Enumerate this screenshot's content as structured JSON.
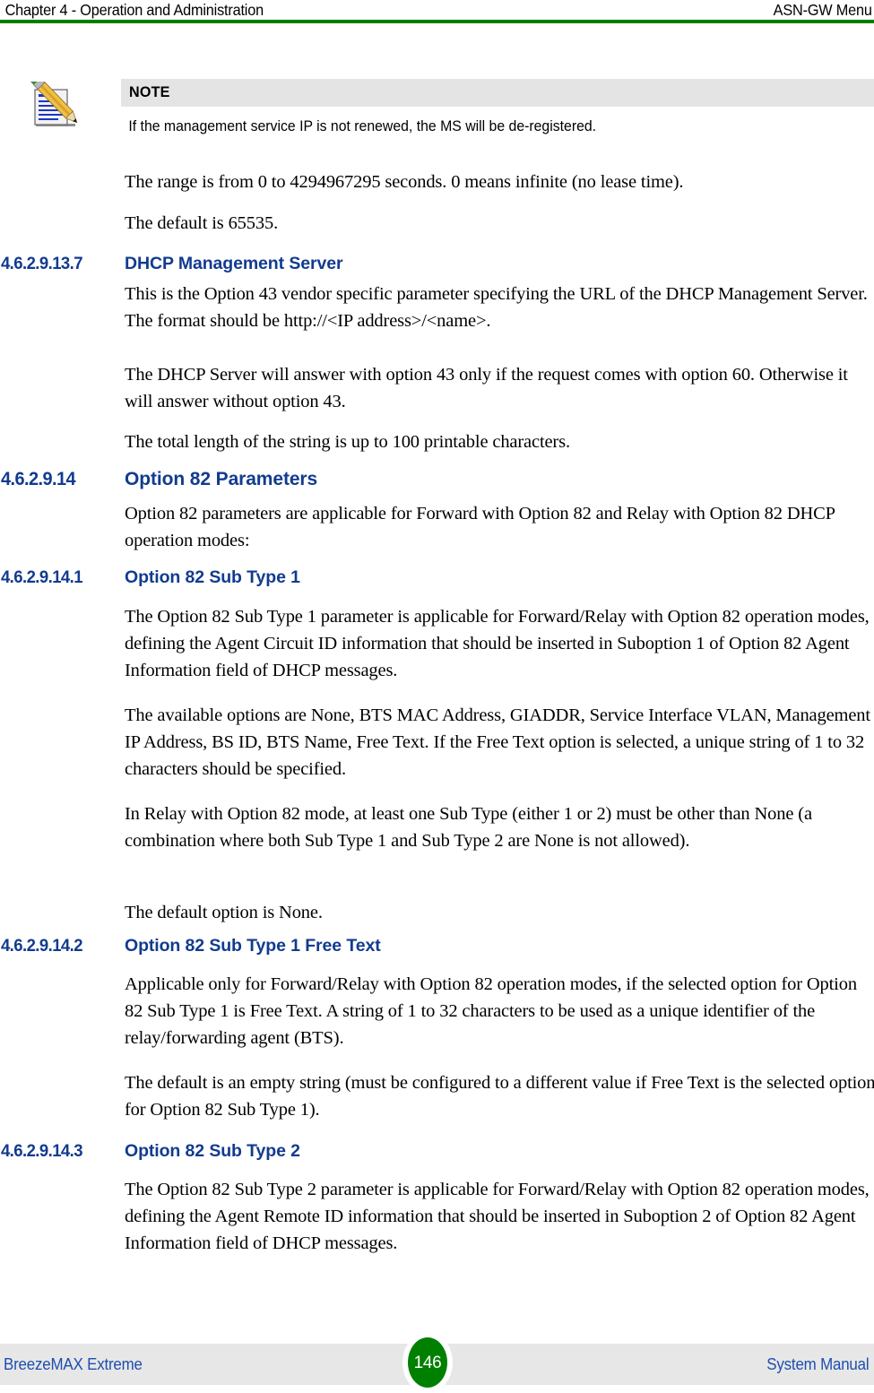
{
  "header": {
    "left": "Chapter 4 - Operation and Administration",
    "right": "ASN-GW Menu",
    "rule_color": "#008000"
  },
  "note": {
    "icon": "note-pencil-icon",
    "title": "NOTE",
    "text": "If the management service IP is not renewed, the MS will be de-registered.",
    "title_bar_color": "#e4e4e4"
  },
  "intro_paragraphs": [
    "The range is from 0 to 4294967295 seconds. 0 means infinite (no lease time).",
    "The default is 65535."
  ],
  "sections": [
    {
      "number": "4.6.2.9.13.7",
      "title": "DHCP Management Server",
      "level": 7,
      "paragraphs": [
        "This is the Option 43 vendor specific parameter specifying the URL of the DHCP Management Server. The format should be http://<IP address>/<name>.",
        "The DHCP Server will answer with option 43 only if the request comes with option 60. Otherwise it will answer without option 43.",
        "The total length of the string is up to 100 printable characters."
      ]
    },
    {
      "number": "4.6.2.9.14",
      "title": "Option 82 Parameters",
      "level": 6,
      "paragraphs": [
        "Option 82 parameters are applicable for Forward with Option 82 and Relay with Option 82 DHCP operation modes:"
      ]
    },
    {
      "number": "4.6.2.9.14.1",
      "title": "Option 82 Sub Type 1",
      "level": 7,
      "paragraphs": [
        "The Option 82 Sub Type 1 parameter is applicable for Forward/Relay with Option 82 operation modes, defining the Agent Circuit ID information that should be inserted in Suboption 1 of Option 82 Agent Information field of DHCP messages.",
        "The available options are None, BTS MAC Address, GIADDR, Service Interface VLAN, Management IP Address, BS ID, BTS Name, Free Text. If the Free Text option is selected, a unique string of 1 to 32 characters should be specified.",
        "In Relay with Option 82 mode, at least one Sub Type (either 1 or 2) must be other than None (a combination where both Sub Type 1 and Sub Type 2 are None is not allowed).",
        "The default option is None."
      ]
    },
    {
      "number": "4.6.2.9.14.2",
      "title": "Option 82 Sub Type 1 Free Text",
      "level": 7,
      "paragraphs": [
        "Applicable only for Forward/Relay with Option 82 operation modes, if the selected option for Option 82 Sub Type 1 is Free Text. A string of 1 to 32 characters to be used as a unique identifier of the relay/forwarding agent (BTS).",
        "The default is an empty string (must be configured to a different value if Free Text is the selected option for Option 82 Sub Type 1)."
      ]
    },
    {
      "number": "4.6.2.9.14.3",
      "title": "Option 82 Sub Type 2",
      "level": 7,
      "paragraphs": [
        "The Option 82 Sub Type 2 parameter is applicable for Forward/Relay with Option 82 operation modes, defining the Agent Remote ID information that should be inserted in Suboption 2 of Option 82 Agent Information field of DHCP messages."
      ]
    }
  ],
  "footer": {
    "left": "BreezeMAX Extreme",
    "page_number": "146",
    "right": "System Manual",
    "band_color": "#e7e7e7",
    "badge_color": "#008000",
    "text_color": "#1d4fae"
  }
}
